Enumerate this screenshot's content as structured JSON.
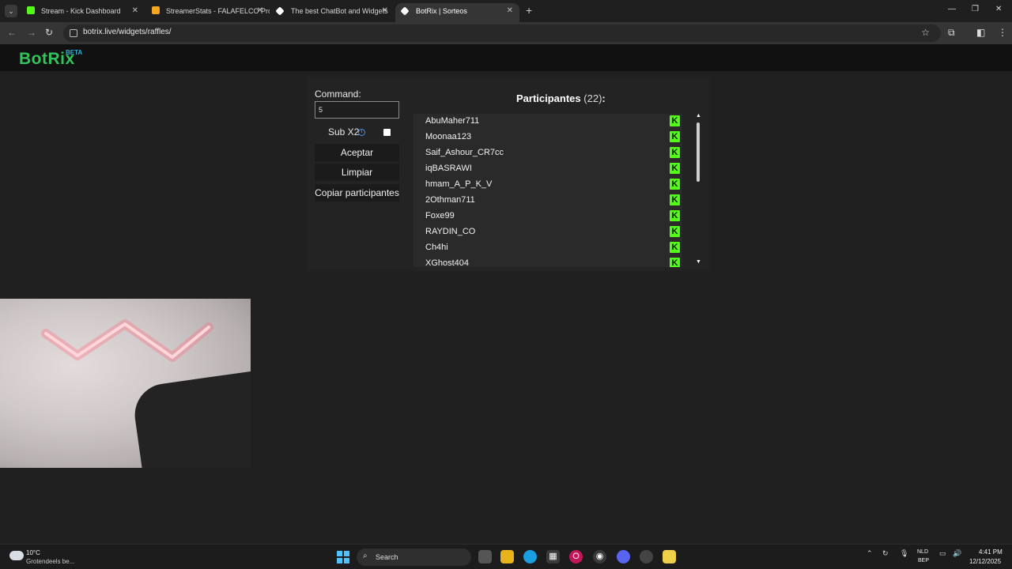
{
  "browser": {
    "tabs": [
      {
        "title": "Stream - Kick Dashboard",
        "favicon_color": "#53fc18",
        "active": false
      },
      {
        "title": "StreamerStats - FALAFELCO Pro",
        "favicon_color": "#f5a623",
        "active": false
      },
      {
        "title": "The best ChatBot and Widgets",
        "favicon_color": "#ffffff",
        "active": false
      },
      {
        "title": "BotRix | Sorteos",
        "favicon_color": "#ffffff",
        "active": true
      }
    ],
    "url": "botrix.live/widgets/raffles/"
  },
  "app": {
    "logo": "BotRix",
    "logo_badge": "BETA",
    "brand_color": "#31c45a"
  },
  "raffle": {
    "command_label": "Command:",
    "command_value": "5",
    "sub_label": "Sub X2",
    "sub_checked": false,
    "accept_label": "Aceptar",
    "clear_label": "Limpiar",
    "copy_label": "Copiar participantes",
    "participants_title": "Participantes",
    "participants_count": "(22)",
    "participants_suffix": ":",
    "participants": [
      "AbuMaher711",
      "Moonaa123",
      "Saif_Ashour_CR7cc",
      "iqBASRAWI",
      "hmam_A_P_K_V",
      "2Othman711",
      "Foxe99",
      "RAYDIN_CO",
      "Ch4hi",
      "XGhost404"
    ],
    "platform_icon": "kick-icon",
    "platform_color": "#53fc18"
  },
  "taskbar": {
    "weather_temp": "10°C",
    "weather_desc": "Grotendeels be...",
    "search_placeholder": "Search",
    "lang_line1": "NLD",
    "lang_line2": "BEP",
    "time": "4:41 PM",
    "date": "12/12/2025"
  }
}
